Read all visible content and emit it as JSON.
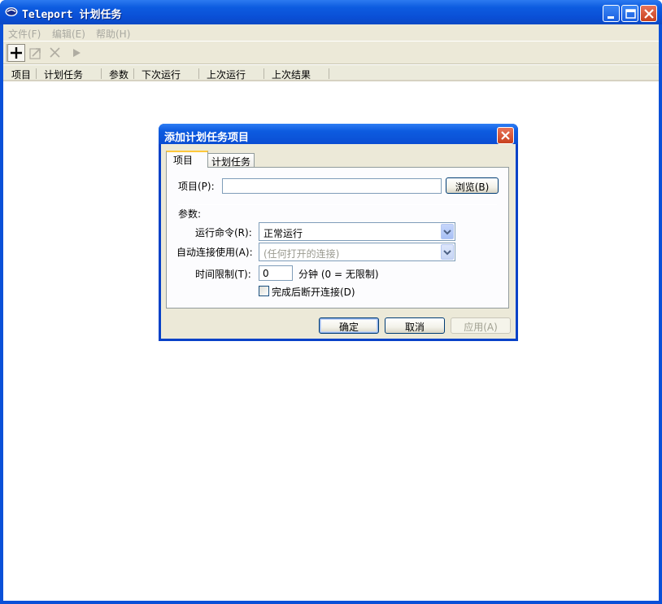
{
  "window": {
    "title": "Teleport 计划任务",
    "colors": {
      "titlebar": "#0a4fd6",
      "menu_disabled": "#a8a8a0",
      "face": "#ece9d8"
    }
  },
  "menu": [
    {
      "label": "文件(F)"
    },
    {
      "label": "编辑(E)"
    },
    {
      "label": "帮助(H)"
    }
  ],
  "toolbar": {
    "tools": [
      {
        "icon": "plus-icon"
      },
      {
        "icon": "edit-icon"
      },
      {
        "icon": "delete-icon"
      },
      {
        "icon": "run-icon"
      }
    ]
  },
  "list": {
    "columns": [
      "项目",
      "计划任务",
      "参数",
      "下次运行",
      "上次运行",
      "上次结果"
    ]
  },
  "dialog": {
    "title": "添加计划任务项目",
    "tabs": [
      "项目",
      "计划任务"
    ],
    "item_label": "项目(P):",
    "item_value": "",
    "browse_label": "浏览(B)",
    "params_label": "参数:",
    "run_cmd_label": "运行命令(R):",
    "run_cmd_value": "正常运行",
    "auto_conn_label": "自动连接使用(A):",
    "auto_conn_value": "(任何打开的连接)",
    "time_limit_label": "时间限制(T):",
    "time_limit_value": "0",
    "time_unit": "分钟 (0 = 无限制)",
    "disconnect_label": "完成后断开连接(D)",
    "disconnect_checked": false,
    "ok_label": "确定",
    "cancel_label": "取消",
    "apply_label": "应用(A)"
  }
}
